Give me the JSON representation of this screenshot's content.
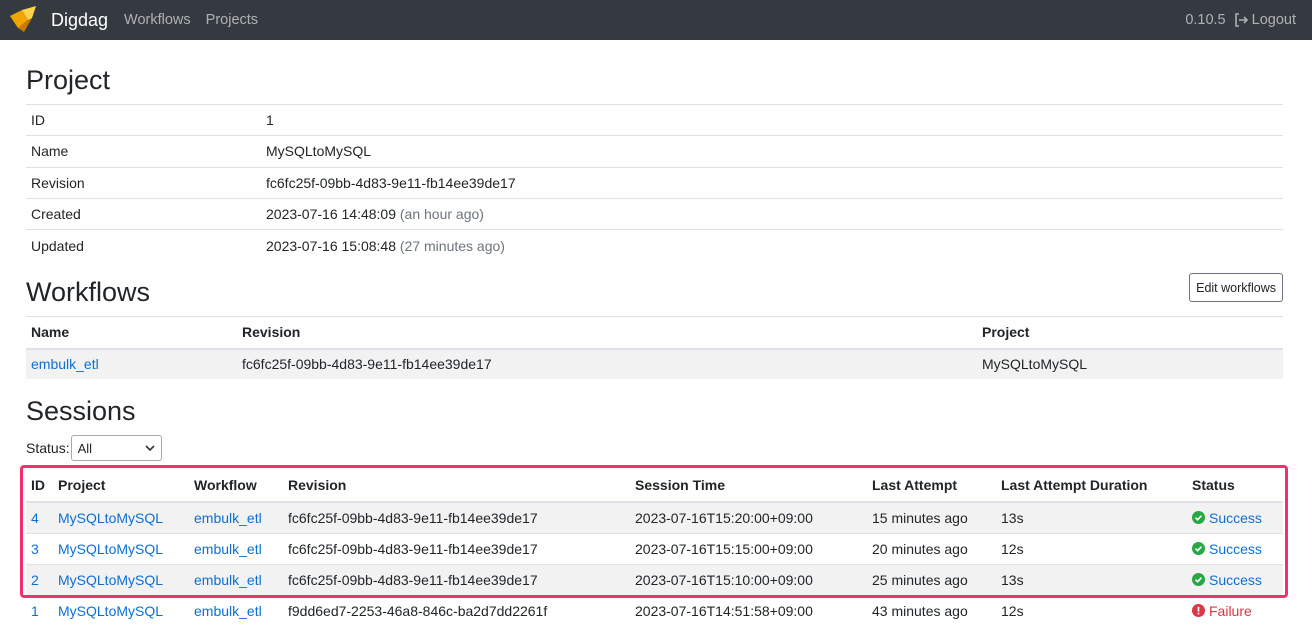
{
  "navbar": {
    "brand": "Digdag",
    "links": [
      "Workflows",
      "Projects"
    ],
    "version": "0.10.5",
    "logout": "Logout"
  },
  "project": {
    "heading": "Project",
    "rows": [
      {
        "key": "ID",
        "value": "1",
        "note": ""
      },
      {
        "key": "Name",
        "value": "MySQLtoMySQL",
        "note": ""
      },
      {
        "key": "Revision",
        "value": "fc6fc25f-09bb-4d83-9e11-fb14ee39de17",
        "note": ""
      },
      {
        "key": "Created",
        "value": "2023-07-16 14:48:09",
        "note": "(an hour ago)"
      },
      {
        "key": "Updated",
        "value": "2023-07-16 15:08:48",
        "note": "(27 minutes ago)"
      }
    ]
  },
  "workflows": {
    "heading": "Workflows",
    "edit_button": "Edit workflows",
    "columns": [
      "Name",
      "Revision",
      "Project"
    ],
    "rows": [
      {
        "name": "embulk_etl",
        "revision": "fc6fc25f-09bb-4d83-9e11-fb14ee39de17",
        "project": "MySQLtoMySQL"
      }
    ]
  },
  "sessions": {
    "heading": "Sessions",
    "status_label": "Status:",
    "status_selected": "All",
    "columns": [
      "ID",
      "Project",
      "Workflow",
      "Revision",
      "Session Time",
      "Last Attempt",
      "Last Attempt Duration",
      "Status"
    ],
    "rows": [
      {
        "id": "4",
        "project": "MySQLtoMySQL",
        "workflow": "embulk_etl",
        "revision": "fc6fc25f-09bb-4d83-9e11-fb14ee39de17",
        "session_time": "2023-07-16T15:20:00+09:00",
        "last_attempt": "15 minutes ago",
        "duration": "13s",
        "status": "Success"
      },
      {
        "id": "3",
        "project": "MySQLtoMySQL",
        "workflow": "embulk_etl",
        "revision": "fc6fc25f-09bb-4d83-9e11-fb14ee39de17",
        "session_time": "2023-07-16T15:15:00+09:00",
        "last_attempt": "20 minutes ago",
        "duration": "12s",
        "status": "Success"
      },
      {
        "id": "2",
        "project": "MySQLtoMySQL",
        "workflow": "embulk_etl",
        "revision": "fc6fc25f-09bb-4d83-9e11-fb14ee39de17",
        "session_time": "2023-07-16T15:10:00+09:00",
        "last_attempt": "25 minutes ago",
        "duration": "13s",
        "status": "Success"
      },
      {
        "id": "1",
        "project": "MySQLtoMySQL",
        "workflow": "embulk_etl",
        "revision": "f9dd6ed7-2253-46a8-846c-ba2d7dd2261f",
        "session_time": "2023-07-16T14:51:58+09:00",
        "last_attempt": "43 minutes ago",
        "duration": "12s",
        "status": "Failure"
      }
    ]
  },
  "colors": {
    "navbar_bg": "#343a40",
    "link": "#0c6fd6",
    "success": "#28a745",
    "failure": "#dc3545",
    "highlight": "#f4306b"
  }
}
